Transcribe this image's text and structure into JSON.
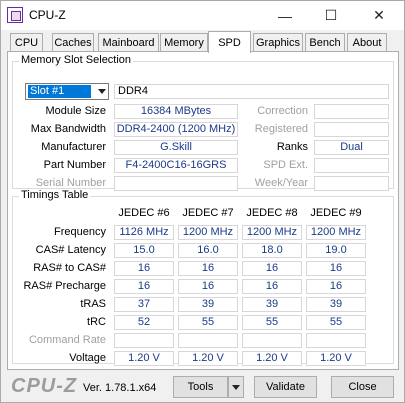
{
  "window": {
    "title": "CPU-Z",
    "icons": {
      "app": "cpu-z-app-icon",
      "minimize": "minimize-icon",
      "maximize": "maximize-icon",
      "close": "close-icon"
    }
  },
  "tabs": [
    "CPU",
    "Caches",
    "Mainboard",
    "Memory",
    "SPD",
    "Graphics",
    "Bench",
    "About"
  ],
  "active_tab": "SPD",
  "slot": {
    "group_title": "Memory Slot Selection",
    "selected": "Slot #1",
    "memory_type": "DDR4",
    "labels": {
      "module_size": "Module Size",
      "max_bandwidth": "Max Bandwidth",
      "manufacturer": "Manufacturer",
      "part_number": "Part Number",
      "serial_number": "Serial Number",
      "correction": "Correction",
      "registered": "Registered",
      "ranks": "Ranks",
      "spd_ext": "SPD Ext.",
      "week_year": "Week/Year"
    },
    "values": {
      "module_size": "16384 MBytes",
      "max_bandwidth": "DDR4-2400 (1200 MHz)",
      "manufacturer": "G.Skill",
      "part_number": "F4-2400C16-16GRS",
      "serial_number": "",
      "correction": "",
      "registered": "",
      "ranks": "Dual",
      "spd_ext": "",
      "week_year": ""
    }
  },
  "timings": {
    "group_title": "Timings Table",
    "columns": [
      "JEDEC #6",
      "JEDEC #7",
      "JEDEC #8",
      "JEDEC #9"
    ],
    "rows": [
      {
        "label": "Frequency",
        "dim": false,
        "values": [
          "1126 MHz",
          "1200 MHz",
          "1200 MHz",
          "1200 MHz"
        ]
      },
      {
        "label": "CAS# Latency",
        "dim": false,
        "values": [
          "15.0",
          "16.0",
          "18.0",
          "19.0"
        ]
      },
      {
        "label": "RAS# to CAS#",
        "dim": false,
        "values": [
          "16",
          "16",
          "16",
          "16"
        ]
      },
      {
        "label": "RAS# Precharge",
        "dim": false,
        "values": [
          "16",
          "16",
          "16",
          "16"
        ]
      },
      {
        "label": "tRAS",
        "dim": false,
        "values": [
          "37",
          "39",
          "39",
          "39"
        ]
      },
      {
        "label": "tRC",
        "dim": false,
        "values": [
          "52",
          "55",
          "55",
          "55"
        ]
      },
      {
        "label": "Command Rate",
        "dim": true,
        "values": [
          "",
          "",
          "",
          ""
        ]
      },
      {
        "label": "Voltage",
        "dim": false,
        "values": [
          "1.20 V",
          "1.20 V",
          "1.20 V",
          "1.20 V"
        ]
      }
    ]
  },
  "footer": {
    "logo": "CPU-Z",
    "version": "Ver. 1.78.1.x64",
    "tools_label": "Tools",
    "validate_label": "Validate",
    "close_label": "Close"
  },
  "colors": {
    "value_text": "#1c3a8a",
    "selection": "#0078d7"
  }
}
